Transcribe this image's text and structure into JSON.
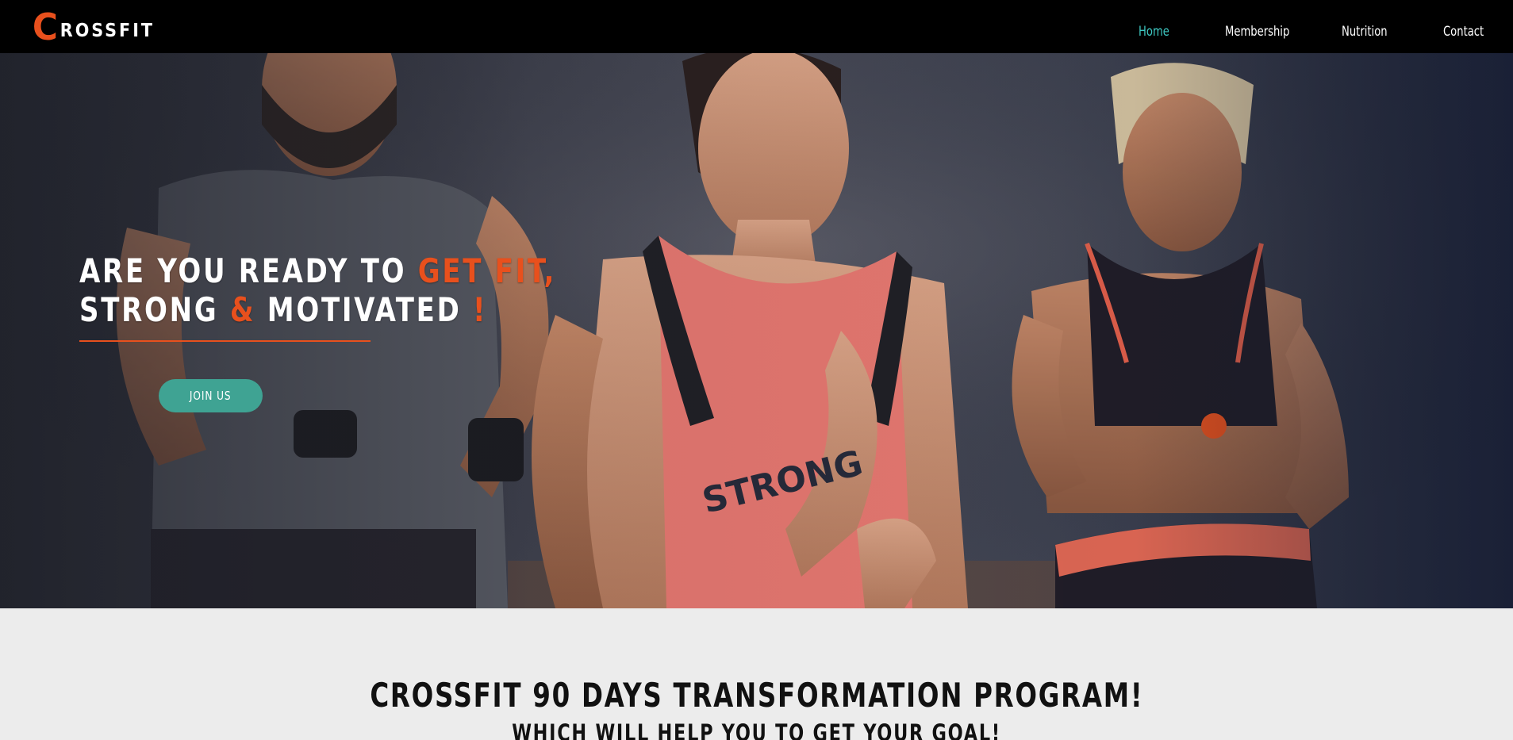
{
  "brand": {
    "logo_initial": "C",
    "logo_rest": "ROSSFIT",
    "logo_color": "#e8501d"
  },
  "nav": {
    "items": [
      {
        "label": "Home",
        "active": true
      },
      {
        "label": "Membership",
        "active": false
      },
      {
        "label": "Nutrition",
        "active": false
      },
      {
        "label": "Contact",
        "active": false
      }
    ],
    "active_color": "#3ec8c2",
    "text_color": "#ffffff"
  },
  "hero": {
    "headline_line1_a": "ARE YOU READY TO ",
    "headline_line1_b": "GET FIT,",
    "headline_line2_a": "STRONG ",
    "headline_line2_amp": "&",
    "headline_line2_b": " MOTIVATED ",
    "headline_line2_excl": "!",
    "cta_label": "JOIN US",
    "accent_color": "#e8501d",
    "cta_color": "#3fa393",
    "background_image": "three athletes running in a gym, woman in coral tank top in the center"
  },
  "program": {
    "title": "CROSSFIT 90 DAYS TRANSFORMATION PROGRAM!",
    "subtitle": "WHICH WILL HELP YOU TO GET YOUR GOAL!"
  }
}
